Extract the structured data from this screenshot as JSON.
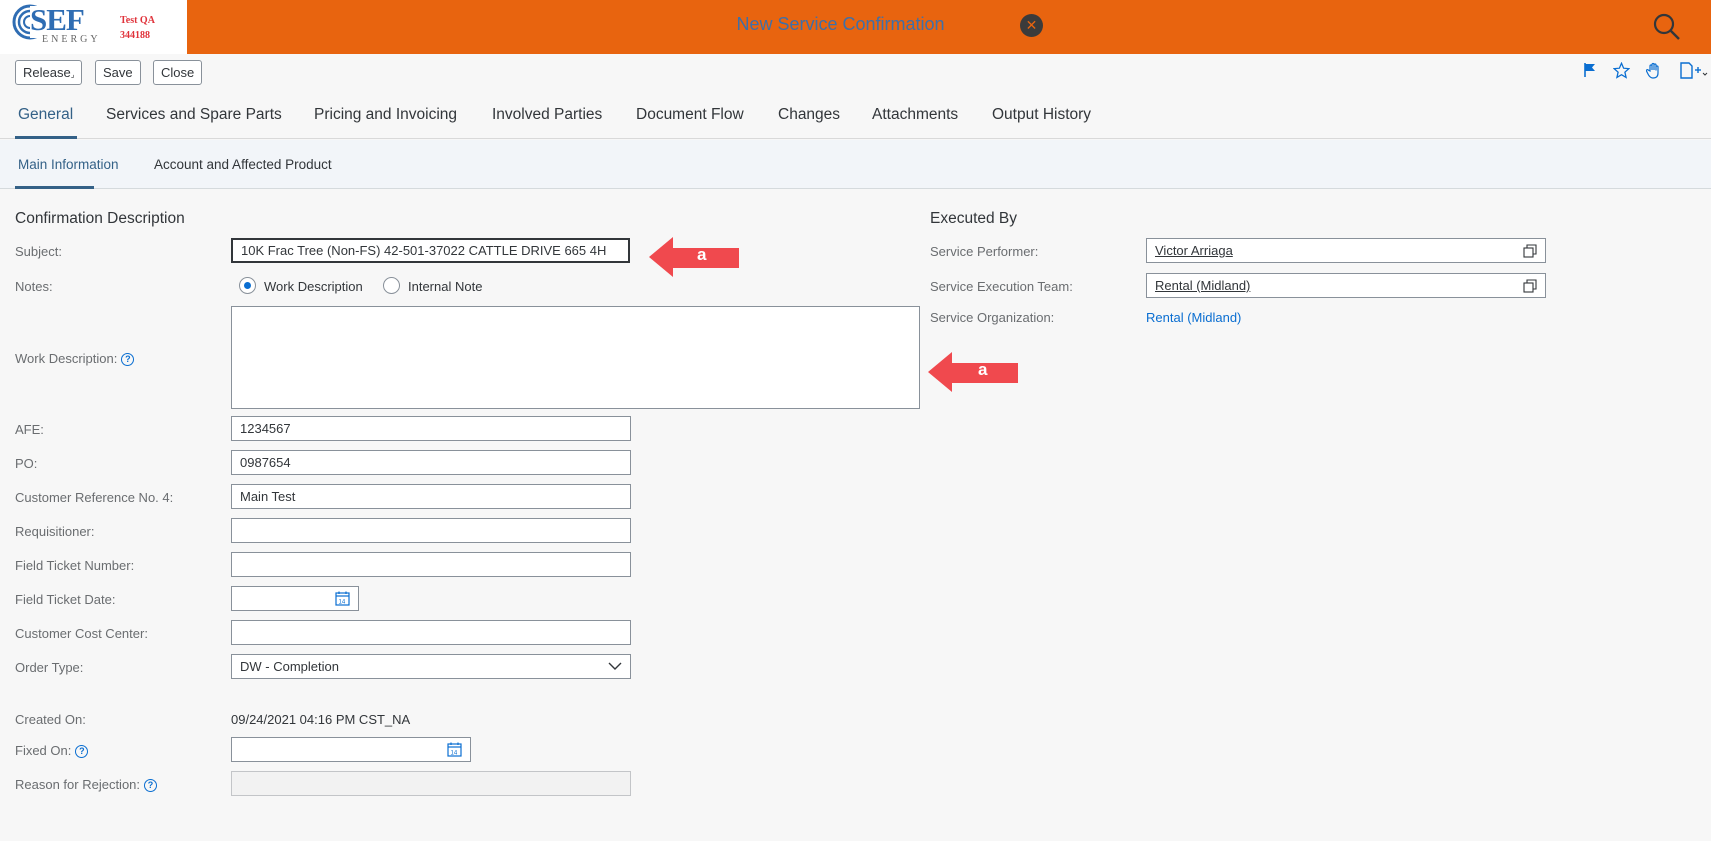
{
  "shell": {
    "logo_text": "SEF",
    "logo_subtext": "ENERGY",
    "env_label": "Test QA",
    "env_number": "344188",
    "title": "New Service Confirmation"
  },
  "toolbar": {
    "release_label": "Release",
    "save_label": "Save",
    "close_label": "Close"
  },
  "tabs": [
    {
      "label": "General"
    },
    {
      "label": "Services and Spare Parts"
    },
    {
      "label": "Pricing and Invoicing"
    },
    {
      "label": "Involved Parties"
    },
    {
      "label": "Document Flow"
    },
    {
      "label": "Changes"
    },
    {
      "label": "Attachments"
    },
    {
      "label": "Output History"
    }
  ],
  "subtabs": [
    {
      "label": "Main Information"
    },
    {
      "label": "Account and Affected Product"
    }
  ],
  "confirmation": {
    "section_title": "Confirmation Description",
    "subject_label": "Subject:",
    "subject_value": "10K Frac Tree (Non-FS)  42-501-37022 CATTLE DRIVE 665 4H",
    "notes_label": "Notes:",
    "notes_options": [
      "Work Description",
      "Internal Note"
    ],
    "notes_selected": "Work Description",
    "work_description_label": "Work Description:",
    "work_description_value": "",
    "afe_label": "AFE:",
    "afe_value": "1234567",
    "po_label": "PO:",
    "po_value": "0987654",
    "customer_ref_label": "Customer Reference No. 4:",
    "customer_ref_value": "Main Test",
    "requisitioner_label": "Requisitioner:",
    "requisitioner_value": "",
    "field_ticket_number_label": "Field Ticket Number:",
    "field_ticket_number_value": "",
    "field_ticket_date_label": "Field Ticket Date:",
    "field_ticket_date_value": "",
    "customer_cost_center_label": "Customer Cost Center:",
    "customer_cost_center_value": "",
    "order_type_label": "Order Type:",
    "order_type_value": "DW - Completion",
    "created_on_label": "Created On:",
    "created_on_value": "09/24/2021 04:16 PM CST_NA",
    "fixed_on_label": "Fixed On:",
    "fixed_on_value": "",
    "reason_rejection_label": "Reason for Rejection:",
    "reason_rejection_value": ""
  },
  "executed_by": {
    "section_title": "Executed By",
    "performer_label": "Service Performer:",
    "performer_value": "Victor Arriaga",
    "execution_team_label": "Service Execution Team:",
    "execution_team_value": "Rental (Midland)",
    "organization_label": "Service Organization:",
    "organization_value": "Rental (Midland)"
  },
  "annotations": [
    {
      "label": "a"
    },
    {
      "label": "a"
    }
  ],
  "colors": {
    "shell_bar": "#e8640f",
    "accent": "#0a6ed1",
    "annotation_arrow": "#f0494e"
  }
}
